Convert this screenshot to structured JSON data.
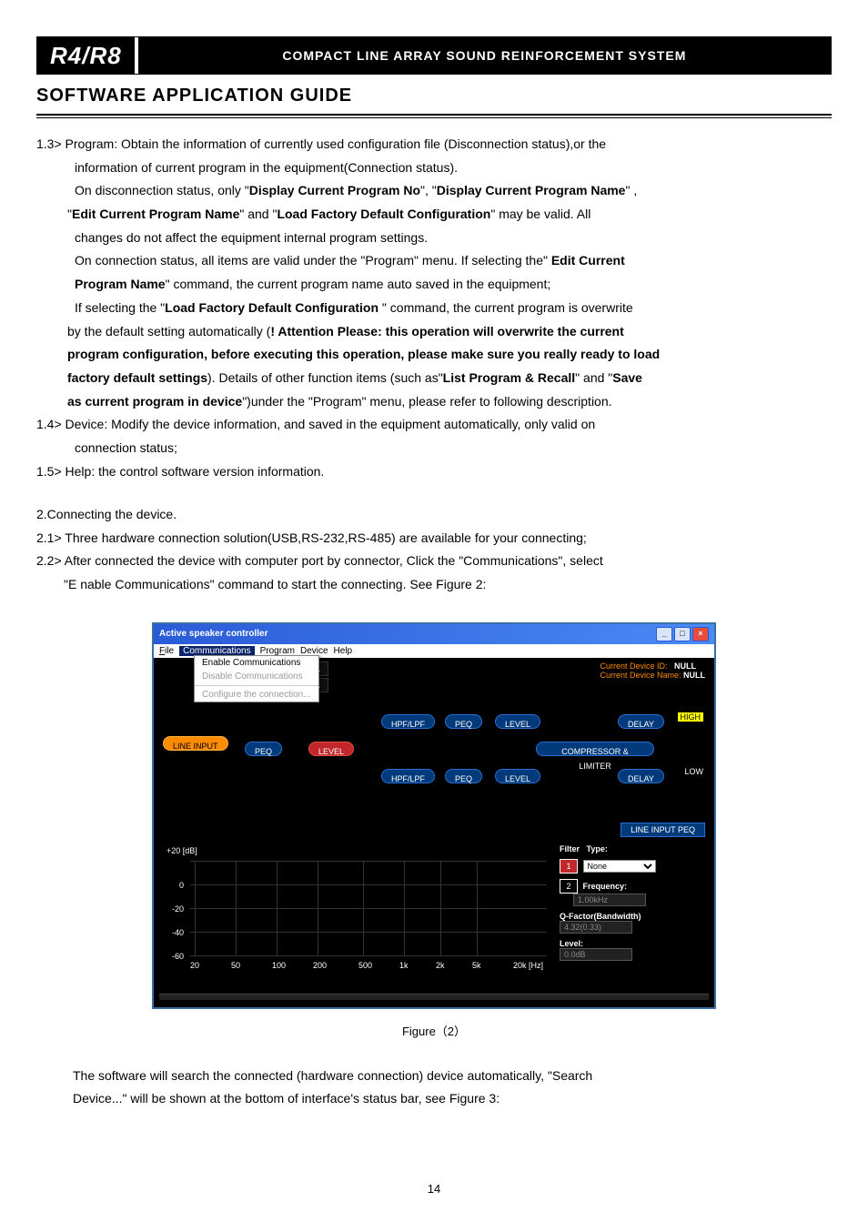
{
  "header": {
    "model": "R4/R8",
    "title": "COMPACT LINE ARRAY SOUND REINFORCEMENT SYSTEM"
  },
  "section_title": "SOFTWARE APPLICATION GUIDE",
  "body": {
    "p1_3_lead": "1.3> Program: Obtain the information of currently used configuration file (Disconnection status),or the",
    "p1_3_l2": "information of current program in the equipment(Connection status).",
    "p1_3_l3a": "On disconnection status, only \"",
    "p1_3_l3b": "Display Current Program No",
    "p1_3_l3c": "\", \"",
    "p1_3_l3d": "Display Current Program Name",
    "p1_3_l3e": "\" ,",
    "p1_3_l4a": "\"",
    "p1_3_l4b": "Edit Current Program Name",
    "p1_3_l4c": "\" and \"",
    "p1_3_l4d": "Load Factory Default Configuration",
    "p1_3_l4e": "\" may be valid. All",
    "p1_3_l5": "changes do not affect the equipment internal program settings.",
    "p1_3_l6a": "On connection status, all items are valid under the  \"Program\" menu. If selecting the\" ",
    "p1_3_l6b": "Edit Current",
    "p1_3_l7a": "Program Name",
    "p1_3_l7b": "\" command, the current program name auto saved in the equipment;",
    "p1_3_l8a": "If selecting the \"",
    "p1_3_l8b": "Load Factory Default Configuration ",
    "p1_3_l8c": "\" command, the current program is overwrite",
    "p1_3_l9a": "by the default setting automatically (",
    "p1_3_l9b": "! Attention Please: this operation will overwrite the current",
    "p1_3_l10": "program configuration, before executing this operation, please make sure you really ready to load",
    "p1_3_l11a": "factory default settings",
    "p1_3_l11b": "). Details of other function items (such as\"",
    "p1_3_l11c": "List Program & Recall",
    "p1_3_l11d": "\" and \"",
    "p1_3_l11e": "Save",
    "p1_3_l12a": "as current program in device",
    "p1_3_l12b": "\")under the \"Program\" menu, please refer to following description.",
    "p1_4_l1": "1.4> Device: Modify the device information, and saved in the equipment automatically, only valid on",
    "p1_4_l2": "connection status;",
    "p1_5": "1.5> Help: the control software version information.",
    "p2": "2.Connecting the device.",
    "p2_1": "2.1> Three hardware connection solution(USB,RS-232,RS-485) are available for your connecting;",
    "p2_2_l1": "2.2> After connected the device with computer port by connector, Click the \"Communications\", select",
    "p2_2_l2": "\"E nable Communications\" command to start the connecting. See Figure 2:"
  },
  "app": {
    "title": "Active speaker controller",
    "menu": {
      "file": "File",
      "comm": "Communications",
      "prog": "Program",
      "dev": "Device",
      "help": "Help"
    },
    "dropdown": {
      "enable": "Enable Communications",
      "disable": "Disable Communications",
      "conf": "Configure the connection..."
    },
    "null": "NULL",
    "devid_lbl": "Current Device ID:",
    "devname_lbl": "Current Device Name:",
    "line_input": "LINE INPUT",
    "peq": "PEQ",
    "level": "LEVEL",
    "hpflpf": "HPF/LPF",
    "comp": "COMPRESSOR & LIMITER",
    "delay": "DELAY",
    "high": "HIGH",
    "low": "LOW",
    "panel_title": "LINE INPUT PEQ",
    "yaxis_top": "+20 [dB]",
    "y0": "0",
    "ym20": "-20",
    "ym40": "-40",
    "ym60": "-60",
    "x20": "20",
    "x50": "50",
    "x100": "100",
    "x200": "200",
    "x500": "500",
    "x1k": "1k",
    "x2k": "2k",
    "x5k": "5k",
    "x20k": "20k [Hz]",
    "filter_lbl": "Filter",
    "f1": "1",
    "f2": "2",
    "type_lbl": "Type:",
    "type_val": "None",
    "freq_lbl": "Frequency:",
    "freq_val": "1.00kHz",
    "q_lbl": "Q-Factor(Bandwidth)",
    "q_val": "4.32(0.33)",
    "level_lbl": "Level:",
    "level_val": "0.0dB"
  },
  "fig_caption": "Figure（2）",
  "closing": {
    "l1": "The software will search the connected (hardware connection) device automatically, \"Search",
    "l2": "Device...\"  will be shown at the bottom of interface's status bar, see Figure 3:"
  },
  "page_num": "14",
  "chart_data": {
    "type": "line",
    "title": "LINE INPUT PEQ",
    "xlabel": "Hz",
    "ylabel": "dB",
    "x_ticks": [
      20,
      50,
      100,
      200,
      500,
      1000,
      2000,
      5000,
      20000
    ],
    "y_ticks": [
      20,
      0,
      -20,
      -40,
      -60
    ],
    "ylim": [
      -60,
      20
    ],
    "series": []
  }
}
